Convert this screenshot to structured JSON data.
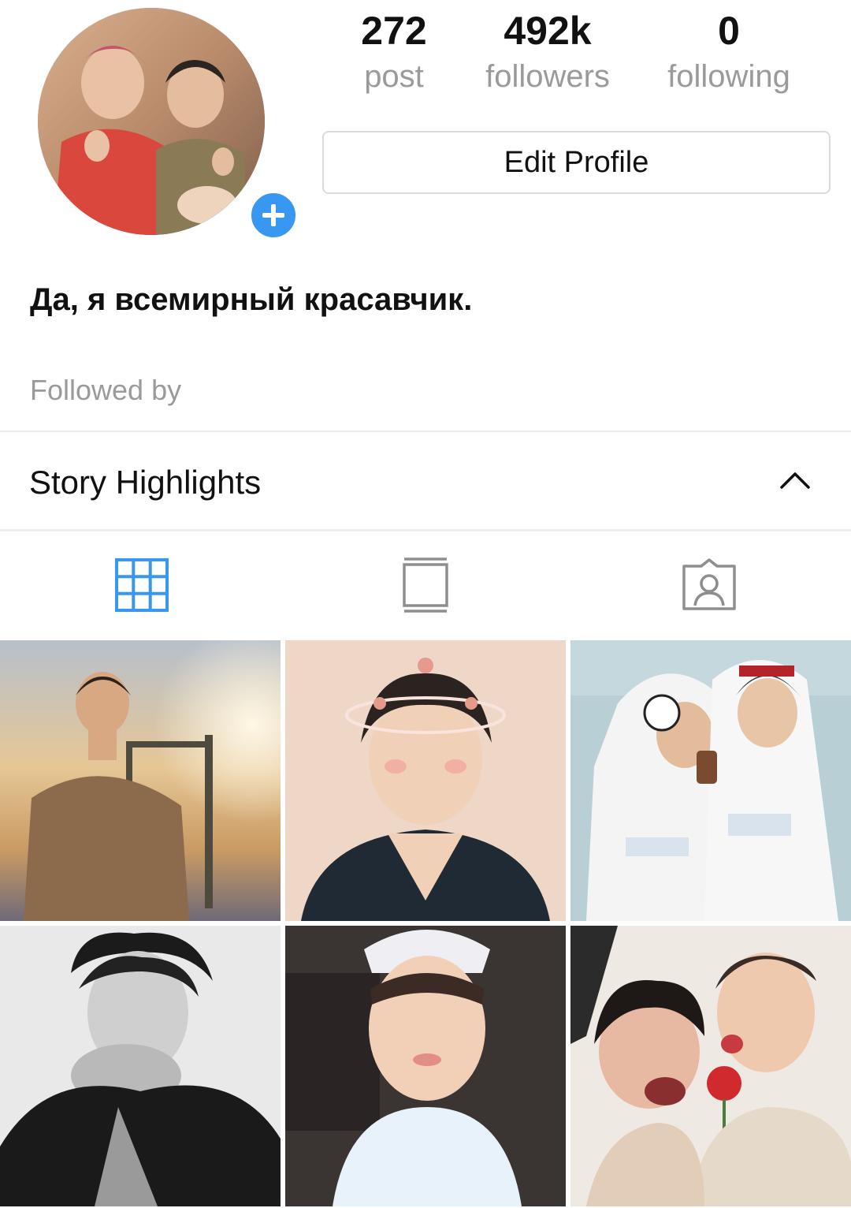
{
  "profile": {
    "stats": {
      "posts_count": "272",
      "posts_label": "post",
      "followers_count": "492k",
      "followers_label": "followers",
      "following_count": "0",
      "following_label": "following"
    },
    "edit_profile_label": "Edit Profile",
    "bio": "Да, я всемирный красавчик.",
    "followed_by_label": "Followed by"
  },
  "highlights": {
    "title": "Story Highlights",
    "expanded": true
  },
  "tabs": [
    {
      "icon": "grid-icon",
      "active": true
    },
    {
      "icon": "feed-icon",
      "active": false
    },
    {
      "icon": "tagged-icon",
      "active": false
    }
  ],
  "colors": {
    "accent": "#3897f0",
    "text_primary": "#111111",
    "text_secondary": "#9a9a9a",
    "border": "#dbdbdb",
    "tab_inactive": "#8e8e8e"
  },
  "grid_posts": [
    {
      "subject": "man in brown shirt against sunset sky"
    },
    {
      "subject": "man with heart crown filter pouting"
    },
    {
      "subject": "two men in white hoodies taking selfie"
    },
    {
      "subject": "black and white portrait with curly hair"
    },
    {
      "subject": "close-up selfie in white cap and tank top"
    },
    {
      "subject": "man and woman posing with red rose"
    }
  ]
}
